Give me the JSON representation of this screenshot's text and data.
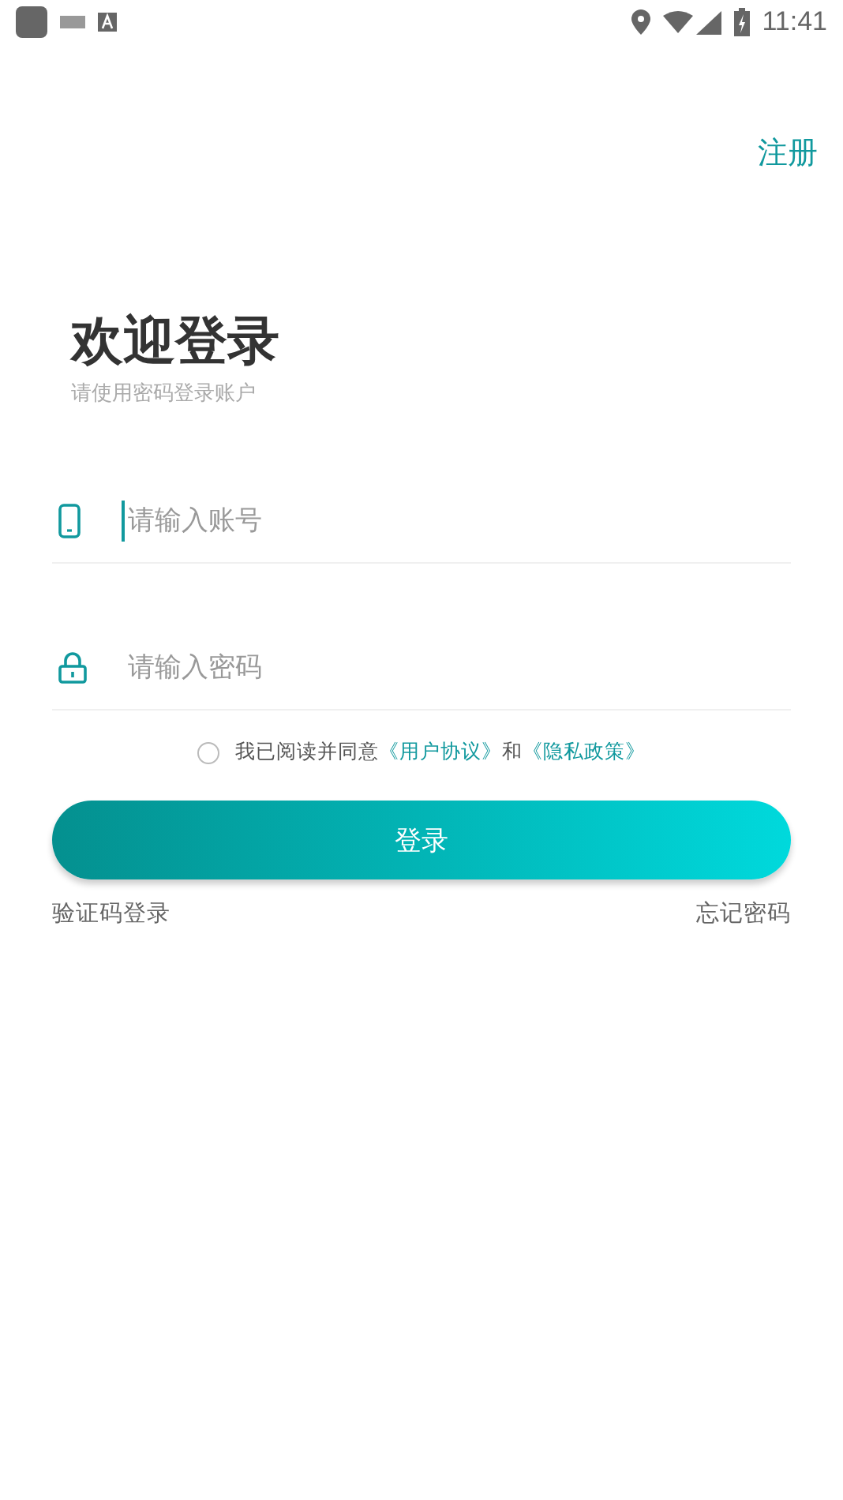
{
  "status_bar": {
    "time": "11:41"
  },
  "header": {
    "register_link": "注册"
  },
  "title": "欢迎登录",
  "subtitle": "请使用密码登录账户",
  "fields": [
    {
      "kind": "phone",
      "placeholder": "请输入账号",
      "focused": true
    },
    {
      "kind": "lock",
      "placeholder": "请输入密码",
      "focused": false
    }
  ],
  "agreement": {
    "checked": false,
    "parts": [
      {
        "kind": "text",
        "text": "我已阅读并同意"
      },
      {
        "kind": "link",
        "text": "《用户协议》"
      },
      {
        "kind": "text",
        "text": "和"
      },
      {
        "kind": "link",
        "text": "《隐私政策》"
      }
    ]
  },
  "login_button": "登录",
  "footer_links": [
    "验证码登录",
    "忘记密码"
  ]
}
